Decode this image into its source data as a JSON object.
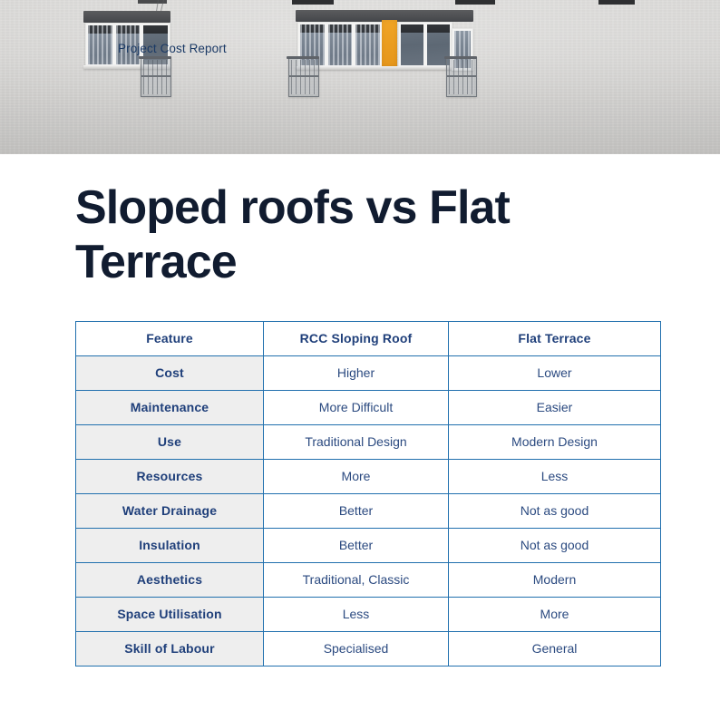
{
  "hero": {
    "label": "Project Cost Report",
    "alt": "building-facade-photo",
    "accent_color": "#e5961b",
    "wall_color": "#d5d4d2"
  },
  "page": {
    "title": "Sloped roofs vs Flat Terrace",
    "title_color": "#111c30"
  },
  "table": {
    "border_color": "#2170ae",
    "header_text_color": "#1f3f7a",
    "feature_cell_bg": "#eeeeee",
    "value_text_color": "#2b4a80",
    "columns": [
      "Feature",
      "RCC Sloping Roof",
      "Flat Terrace"
    ],
    "rows": [
      {
        "feature": "Cost",
        "sloping": "Higher",
        "flat": "Lower"
      },
      {
        "feature": "Maintenance",
        "sloping": "More Difficult",
        "flat": "Easier"
      },
      {
        "feature": "Use",
        "sloping": "Traditional Design",
        "flat": "Modern Design"
      },
      {
        "feature": "Resources",
        "sloping": "More",
        "flat": "Less"
      },
      {
        "feature": "Water Drainage",
        "sloping": "Better",
        "flat": "Not as good"
      },
      {
        "feature": "Insulation",
        "sloping": "Better",
        "flat": "Not as good"
      },
      {
        "feature": "Aesthetics",
        "sloping": "Traditional, Classic",
        "flat": "Modern"
      },
      {
        "feature": "Space Utilisation",
        "sloping": "Less",
        "flat": "More"
      },
      {
        "feature": "Skill of Labour",
        "sloping": "Specialised",
        "flat": "General"
      }
    ]
  }
}
